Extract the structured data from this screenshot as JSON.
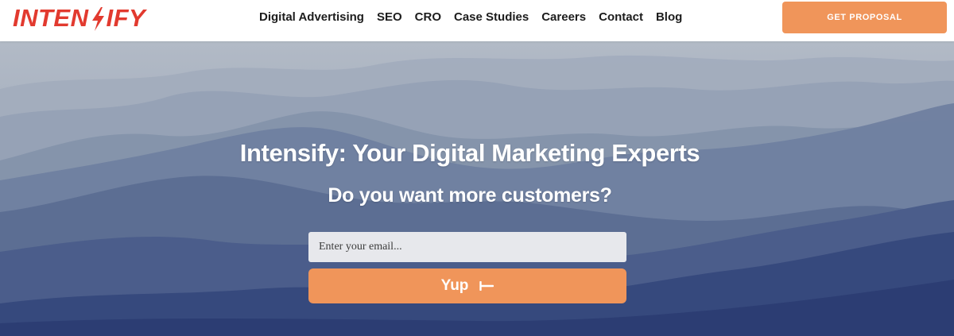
{
  "brand": {
    "logo_text_before": "INTEN",
    "logo_text_after": "IFY",
    "logo_color": "#e23a2f"
  },
  "nav": {
    "items": [
      {
        "label": "Digital Advertising"
      },
      {
        "label": "SEO"
      },
      {
        "label": "CRO"
      },
      {
        "label": "Case Studies"
      },
      {
        "label": "Careers"
      },
      {
        "label": "Contact"
      },
      {
        "label": "Blog"
      }
    ],
    "cta_label": "GET PROPOSAL"
  },
  "hero": {
    "title": "Intensify: Your Digital Marketing Experts",
    "subtitle": "Do you want more customers?",
    "email": {
      "placeholder": "Enter your email...",
      "value": ""
    },
    "submit_label": "Yup",
    "submit_icon": "arrow-left-icon"
  },
  "colors": {
    "accent": "#f0955a",
    "brand_red": "#e23a2f",
    "hero_sky": "#a9b3c2",
    "hero_deep": "#2f417a"
  }
}
